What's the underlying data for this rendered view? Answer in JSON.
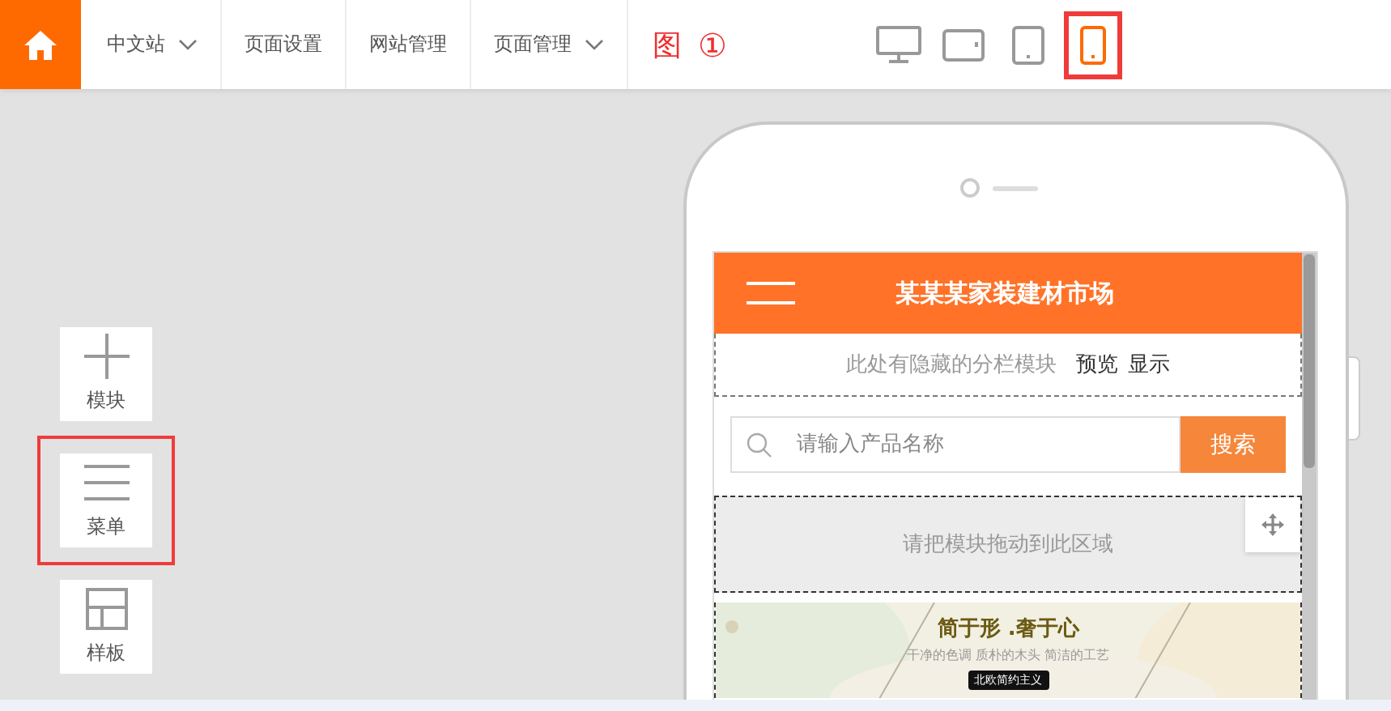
{
  "topbar": {
    "nav": [
      {
        "label": "中文站",
        "dropdown": true
      },
      {
        "label": "页面设置",
        "dropdown": false
      },
      {
        "label": "网站管理",
        "dropdown": false
      },
      {
        "label": "页面管理",
        "dropdown": true
      }
    ],
    "annotation": {
      "label": "图",
      "number": "①"
    },
    "devices": [
      {
        "kind": "desktop",
        "selected": false,
        "highlighted": false
      },
      {
        "kind": "tablet-landscape",
        "selected": false,
        "highlighted": false
      },
      {
        "kind": "tablet",
        "selected": false,
        "highlighted": false
      },
      {
        "kind": "phone",
        "selected": true,
        "highlighted": true
      }
    ]
  },
  "tools": [
    {
      "kind": "plus",
      "label": "模块",
      "highlighted": false
    },
    {
      "kind": "menu",
      "label": "菜单",
      "highlighted": true
    },
    {
      "kind": "layout",
      "label": "样板",
      "highlighted": false
    }
  ],
  "preview": {
    "site_title": "某某某家装建材市场",
    "hidden_notice": {
      "text": "此处有隐藏的分栏模块",
      "links": [
        "预览",
        "显示"
      ]
    },
    "search": {
      "placeholder": "请输入产品名称",
      "button": "搜索"
    },
    "drop_zone": "请把模块拖动到此区域",
    "banner": {
      "kind": "picture",
      "title": "简于形 .奢于心",
      "subtitle": "干净的色调 质朴的木头 简洁的工艺",
      "tag": "北欧简约主义"
    }
  }
}
